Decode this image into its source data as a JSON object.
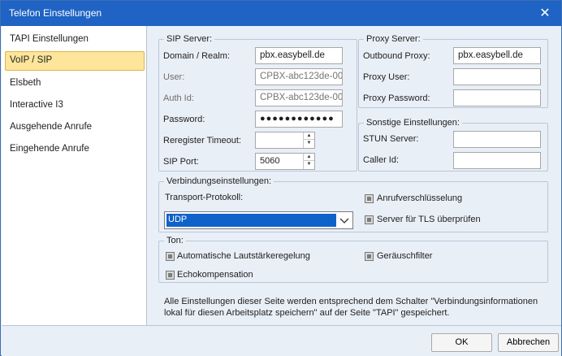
{
  "window": {
    "title": "Telefon Einstellungen"
  },
  "sidebar": {
    "items": [
      {
        "label": "TAPI Einstellungen"
      },
      {
        "label": "VoIP / SIP"
      },
      {
        "label": "Elsbeth"
      },
      {
        "label": "Interactive I3"
      },
      {
        "label": "Ausgehende Anrufe"
      },
      {
        "label": "Eingehende Anrufe"
      }
    ],
    "selected": "VoIP / SIP"
  },
  "sip_server": {
    "legend": "SIP Server:",
    "domain_label": "Domain / Realm:",
    "domain_value": "pbx.easybell.de",
    "user_label": "User:",
    "user_value": "CPBX-abc123de-00",
    "auth_label": "Auth Id:",
    "auth_value": "CPBX-abc123de-00",
    "password_label": "Password:",
    "password_value": "●●●●●●●●●●●●",
    "reregister_label": "Reregister Timeout:",
    "reregister_value": "",
    "port_label": "SIP Port:",
    "port_value": "5060"
  },
  "proxy": {
    "legend": "Proxy Server:",
    "outbound_label": "Outbound Proxy:",
    "outbound_value": "pbx.easybell.de",
    "user_label": "Proxy User:",
    "user_value": "",
    "password_label": "Proxy Password:",
    "password_value": ""
  },
  "other": {
    "legend": "Sonstige Einstellungen:",
    "stun_label": "STUN Server:",
    "stun_value": "",
    "caller_label": "Caller Id:",
    "caller_value": ""
  },
  "connection": {
    "legend": "Verbindungseinstellungen:",
    "transport_label": "Transport-Protokoll:",
    "transport_value": "UDP",
    "encryption_label": "Anrufverschlüsselung",
    "tls_label": "Server für TLS überprüfen"
  },
  "sound": {
    "legend": "Ton:",
    "agc_label": "Automatische Lautstärkeregelung",
    "noise_label": "Geräuschfilter",
    "echo_label": "Echokompensation"
  },
  "note": "Alle Einstellungen dieser Seite werden entsprechend dem Schalter \"Verbindungsinformationen lokal für diesen Arbeitsplatz speichern\" auf der Seite \"TAPI\" gespeichert.",
  "buttons": {
    "ok": "OK",
    "cancel": "Abbrechen"
  },
  "colors": {
    "titlebar": "#1f63c4",
    "selection": "#fde59b",
    "dropdown_highlight": "#0e62c9"
  },
  "icons": {
    "close": "close-icon",
    "dropdown": "chevron-down-icon",
    "spinner_up": "arrow-up-icon",
    "spinner_down": "arrow-down-icon"
  }
}
